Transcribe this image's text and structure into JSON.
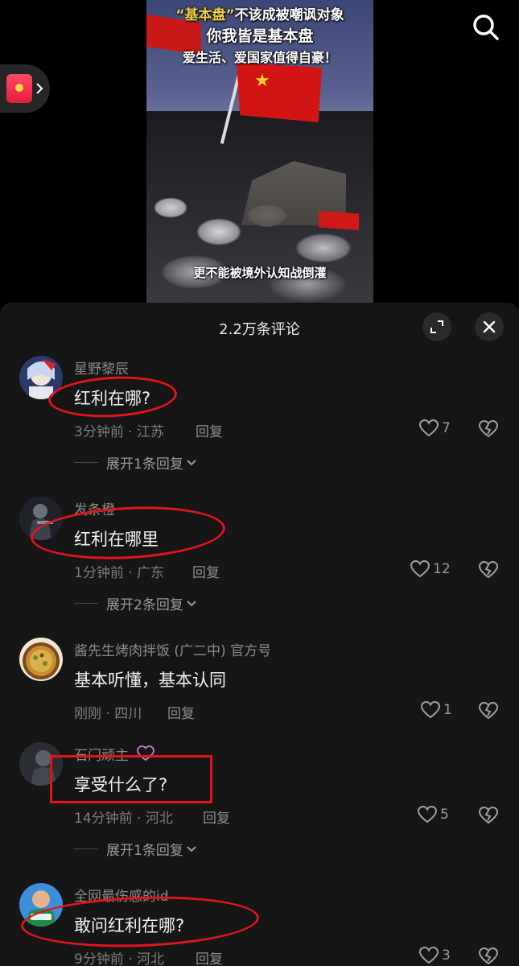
{
  "video": {
    "title_quote": "“基本盘”",
    "title_rest": "不该成被嘲讽对象",
    "title_line2": "你我皆是基本盘",
    "title_line3": "爱生活、爱国家值得自豪！",
    "subtitle": "更不能被境外认知战倒灌"
  },
  "panel": {
    "title": "2.2万条评论"
  },
  "reply_label": "回复",
  "comments": [
    {
      "user": "星野黎辰",
      "text": "红利在哪?",
      "meta": "3分钟前 · 江苏",
      "likes": "7",
      "expand": "展开1条回复"
    },
    {
      "user": "发条橙",
      "text": "红利在哪里",
      "meta": "1分钟前 · 广东",
      "likes": "12",
      "expand": "展开2条回复"
    },
    {
      "user": "酱先生烤肉拌饭 (广二中) 官方号",
      "text": "基本听懂，基本认同",
      "meta": "刚刚 · 四川",
      "likes": "1",
      "expand": ""
    },
    {
      "user": "石门顽主",
      "text": "享受什么了?",
      "meta": "14分钟前 · 河北",
      "likes": "5",
      "expand": "展开1条回复"
    },
    {
      "user": "全网最伤感的id",
      "text": "敢问红利在哪?",
      "meta": "9分钟前 · 河北",
      "likes": "3",
      "expand": ""
    }
  ],
  "colors": {
    "panel_bg": "#161616",
    "annotation_red": "#e1141c",
    "flag_red": "#d21414"
  }
}
